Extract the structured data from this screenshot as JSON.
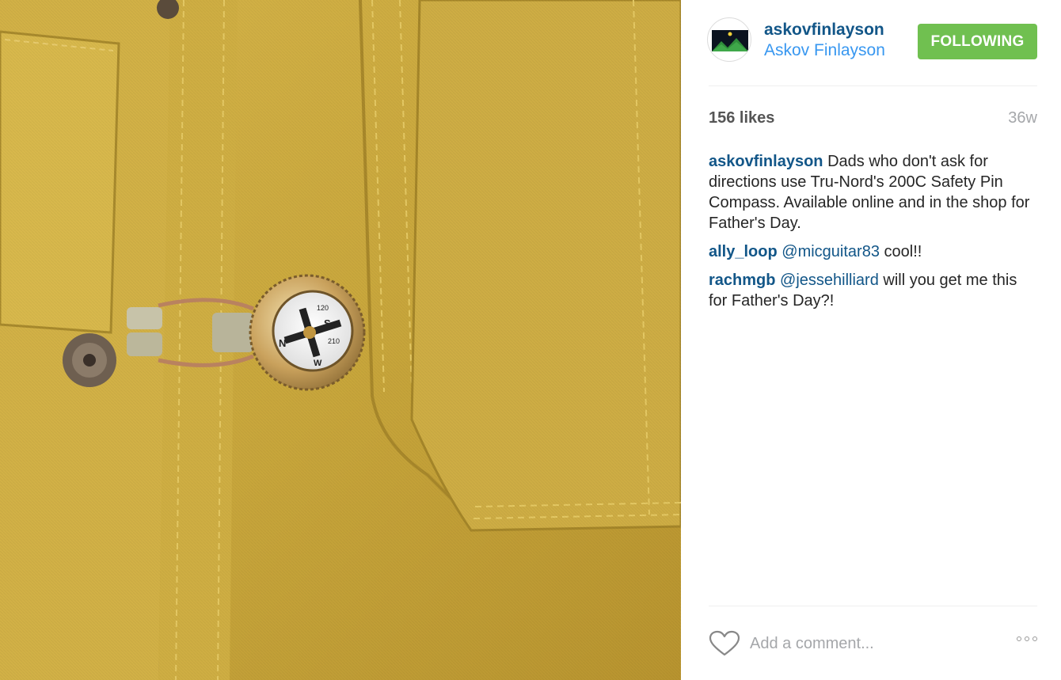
{
  "post": {
    "image_alt_icon": "photo-jacket-compass",
    "author": {
      "username": "askovfinlayson",
      "full_name": "Askov Finlayson",
      "avatar_icon": "mountain-logo-icon"
    },
    "follow_button": "FOLLOWING",
    "likes": "156 likes",
    "age": "36w",
    "caption": {
      "user": "askovfinlayson",
      "text": "Dads who don't ask for directions use Tru-Nord's 200C Safety Pin Compass. Available online and in the shop for Father's Day."
    },
    "comments": [
      {
        "user": "ally_loop",
        "mention": "@micguitar83",
        "text": "cool!!"
      },
      {
        "user": "rachmgb",
        "mention": "@jessehilliard",
        "text": "will you get me this for Father's Day?!"
      }
    ],
    "add_comment_placeholder": "Add a comment...",
    "icons": {
      "like": "heart-icon",
      "more": "more-options-icon"
    },
    "colors": {
      "link": "#125688",
      "follow_bg": "#70c050",
      "secondary": "#3897f0",
      "fabric": "#c9a93c"
    }
  }
}
